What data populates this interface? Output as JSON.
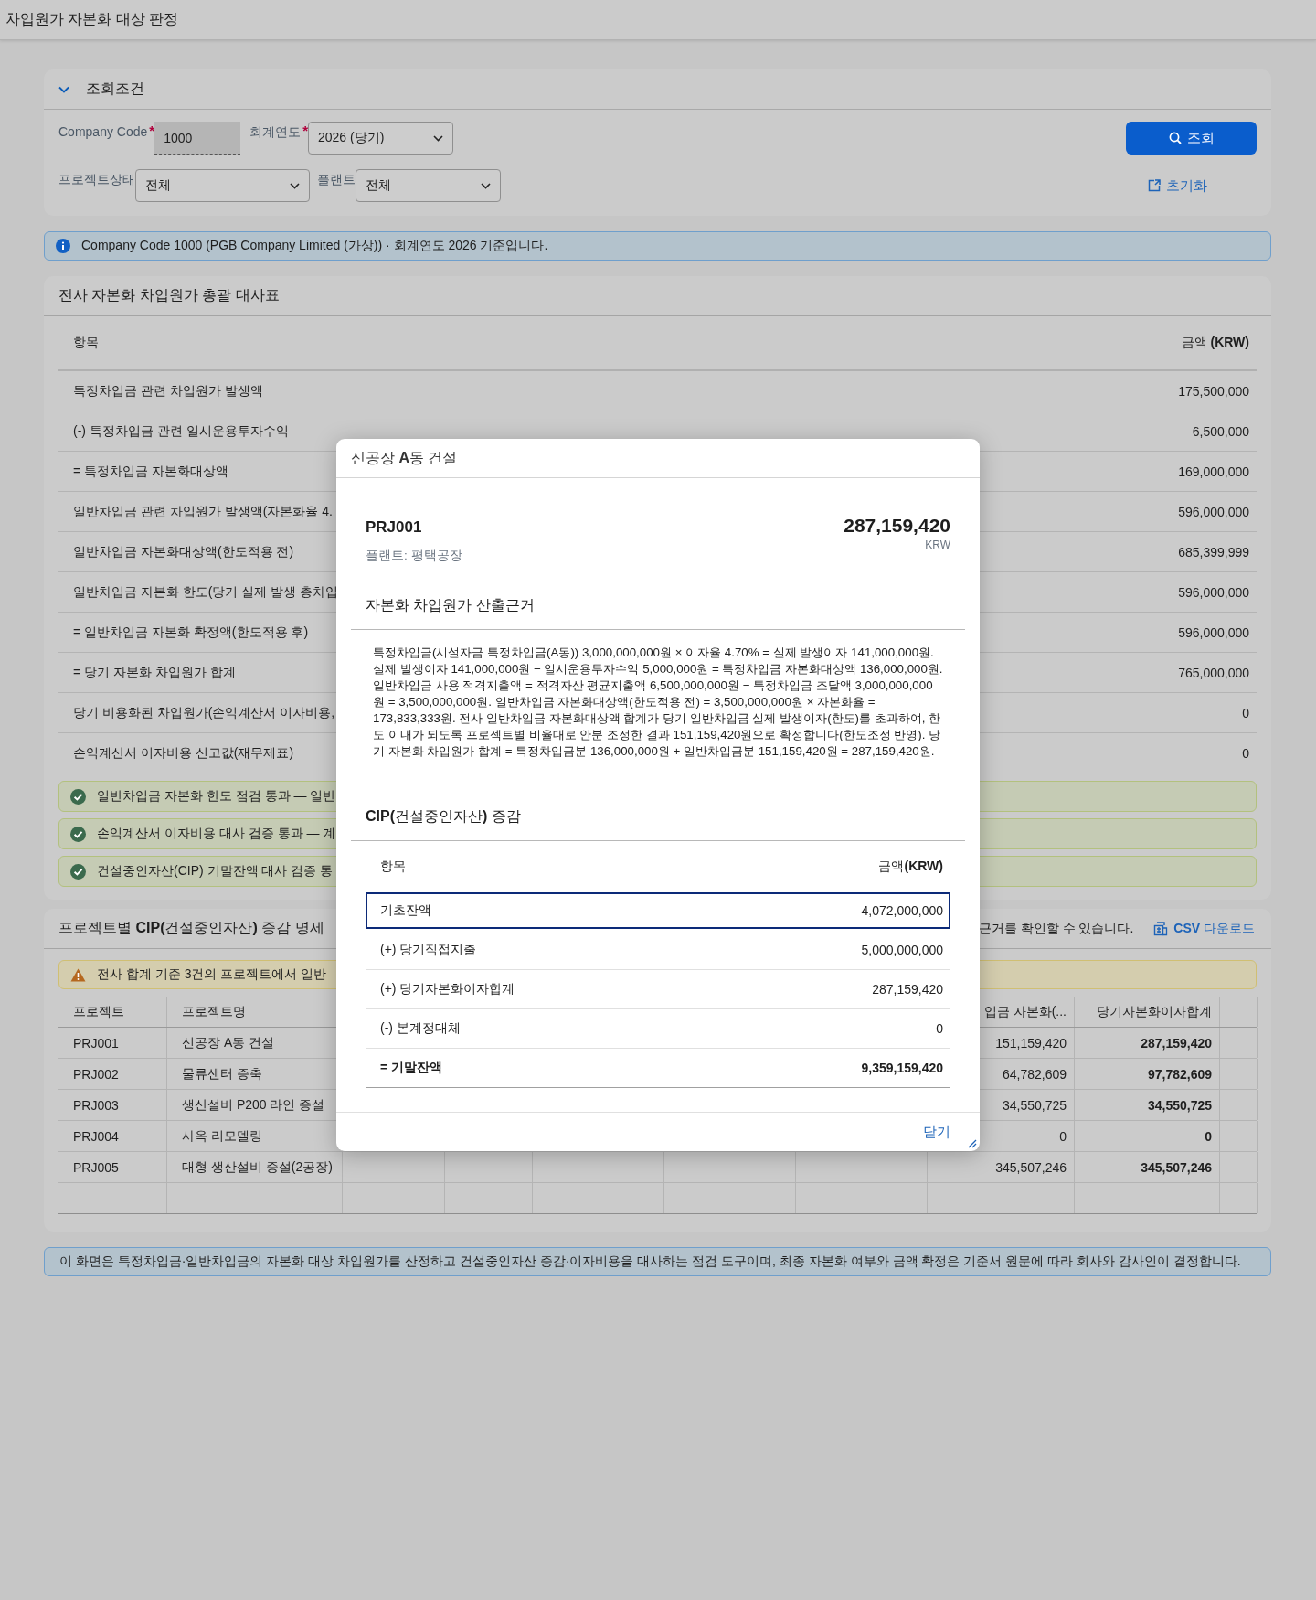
{
  "app_title": "차입원가 자본화 대상 판정",
  "filter": {
    "title": "조회조건",
    "expanded": true,
    "fields": [
      {
        "label": "Company Code",
        "required_mark": "*",
        "kind": "input",
        "value": "1000"
      },
      {
        "label": "회계연도",
        "required_mark": "*",
        "kind": "select",
        "value": "2026 (당기)"
      },
      {
        "label": "프로젝트상태",
        "kind": "select",
        "value": "전체"
      },
      {
        "label": "플랜트",
        "kind": "select",
        "value": "전체"
      }
    ],
    "search_button": "조회",
    "reset_link": "초기화"
  },
  "info_message": {
    "kind": "info",
    "text": "Company Code 1000 (PGB Company Limited (가상)) · 회계연도 2026 기준입니다."
  },
  "summary": {
    "title": "전사 자본화 차입원가 총괄 대사표",
    "columns": [
      "항목",
      "금액 **(KRW)**"
    ],
    "rows": [
      {
        "label": "특정차입금 관련 차입원가 발생액",
        "amount": "175,500,000"
      },
      {
        "label": "(-) 특정차입금 관련 일시운용투자수익",
        "amount": "6,500,000"
      },
      {
        "label": "= 특정차입금 자본화대상액",
        "amount": "169,000,000"
      },
      {
        "label": "일반차입금 관련 차입원가 발생액(자본화율 4.",
        "amount": "596,000,000"
      },
      {
        "label": "일반차입금 자본화대상액(한도적용 전)",
        "amount": "685,399,999"
      },
      {
        "label": "일반차입금 자본화 한도(당기 실제 발생 총차입",
        "amount": "596,000,000"
      },
      {
        "label": "= 일반차입금 자본화 확정액(한도적용 후)",
        "amount": "596,000,000"
      },
      {
        "label": "= 당기 자본화 차입원가 합계",
        "amount": "765,000,000"
      },
      {
        "label": "당기 비용화된 차입원가(손익계산서 이자비용,",
        "amount": "0"
      },
      {
        "label": "손익계산서 이자비용 신고값(재무제표)",
        "amount": "0"
      }
    ],
    "checks": [
      {
        "kind": "success",
        "text": "일반차입금 자본화 한도 점검 통과 — 일반"
      },
      {
        "kind": "success",
        "text": "손익계산서 이자비용 대사 검증 통과 — 계"
      },
      {
        "kind": "success",
        "text": "건설중인자산(CIP) 기말잔액 대사 검증 통"
      }
    ]
  },
  "projects": {
    "title": "프로젝트별 **CIP(**건설중인자산**)** 증감 명세",
    "hint": "근거를 확인할 수 있습니다.",
    "download_button": "**CSV** 다운로드",
    "warning": {
      "kind": "warning",
      "text": "전사 합계 기준 3건의 프로젝트에서 일반"
    },
    "columns": [
      "프로젝트",
      "프로젝트명",
      "입금 자본화(...",
      "당기자본화이자합계"
    ],
    "rows": [
      {
        "cells": [
          "PRJ001",
          "신공장 A동 건설",
          "151,159,420",
          "287,159,420"
        ]
      },
      {
        "cells": [
          "PRJ002",
          "물류센터 증축",
          "64,782,609",
          "97,782,609"
        ]
      },
      {
        "cells": [
          "PRJ003",
          "생산설비 P200 라인 증설",
          "34,550,725",
          "34,550,725"
        ]
      },
      {
        "cells": [
          "PRJ004",
          "사옥 리모델링",
          "0",
          "0"
        ]
      },
      {
        "cells": [
          "PRJ005",
          "대형 생산설비 증설(2공장)",
          "345,507,246",
          "345,507,246"
        ]
      }
    ]
  },
  "footer_note": {
    "text": "이 화면은 특정차입금·일반차입금의 자본화 대상 차입원가를 산정하고 건설중인자산 증감·이자비용을 대사하는 점검 도구이며, 최종 자본화 여부와 금액 확정은 기준서 원문에 따라 회사와 감사인이 결정합니다."
  },
  "dialog": {
    "title": "신공장 **A**동 건설",
    "project_id": "PRJ001",
    "amount": "287,159,420",
    "currency": "KRW",
    "plant": "플랜트: 평택공장",
    "basis_title": "자본화 차입원가 산출근거",
    "basis_text": "특정차입금(시설자금 특정차입금(A동)) 3,000,000,000원 × 이자율 4.70% = 실제 발생이자 141,000,000원. 실제 발생이자 141,000,000원 − 일시운용투자수익 5,000,000원 = 특정차입금 자본화대상액 136,000,000원. 일반차입금 사용 적격지출액 = 적격자산 평균지출액 6,500,000,000원 − 특정차입금 조달액 3,000,000,000원 = 3,500,000,000원. 일반차입금 자본화대상액(한도적용 전) = 3,500,000,000원 × 자본화율 = 173,833,333원. 전사 일반차입금 자본화대상액 합계가 당기 일반차입금 실제 발생이자(한도)를 초과하여, 한도 이내가 되도록 프로젝트별 비율대로 안분 조정한 결과 151,159,420원으로 확정합니다(한도조정 반영). 당기 자본화 차입원가 합계 = 특정차입금분 136,000,000원 + 일반차입금분 151,159,420원 = 287,159,420원.",
    "cip_title": "**CIP(**건설중인자산**)** 증감",
    "cip_columns": [
      "항목",
      "금액**(KRW)**"
    ],
    "cip_rows": [
      {
        "kind": "item",
        "label": "기초잔액",
        "amount": "4,072,000,000",
        "selected": true
      },
      {
        "kind": "item",
        "label": "(+) 당기직접지출",
        "amount": "5,000,000,000",
        "selected": false
      },
      {
        "kind": "item",
        "label": "(+) 당기자본화이자합계",
        "amount": "287,159,420",
        "selected": false
      },
      {
        "kind": "item",
        "label": "(-) 본계정대체",
        "amount": "0",
        "selected": false
      },
      {
        "kind": "total",
        "label": "= 기말잔액",
        "amount": "9,359,159,420",
        "selected": false
      }
    ],
    "close_button": "닫기"
  }
}
